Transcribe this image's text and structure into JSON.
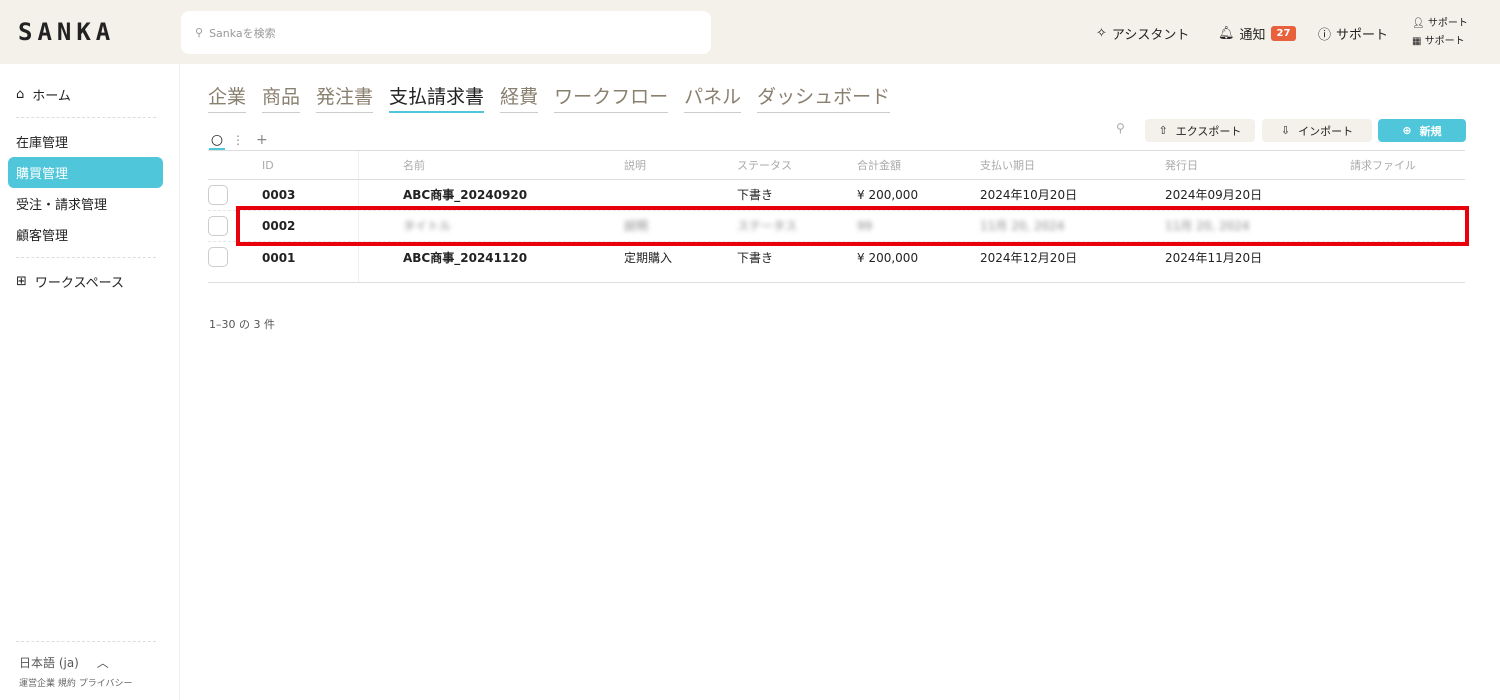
{
  "header": {
    "logo": "SANKA",
    "search_placeholder": "Sankaを検索",
    "assistant": "アシスタント",
    "notifications": "通知",
    "notification_count": "27",
    "support": "サポート",
    "user_line1": "サポート",
    "user_line2": "サポート"
  },
  "sidebar": {
    "home": "ホーム",
    "items": [
      "在庫管理",
      "購買管理",
      "受注・請求管理",
      "顧客管理"
    ],
    "workspace": "ワークスペース",
    "language": "日本語 (ja)",
    "footer": "運営企業 規約 プライバシー"
  },
  "tabs": [
    "企業",
    "商品",
    "発注書",
    "支払請求書",
    "経費",
    "ワークフロー",
    "パネル",
    "ダッシュボード"
  ],
  "toolbar": {
    "export": "エクスポート",
    "import": "インポート",
    "new": "新規"
  },
  "table": {
    "columns": [
      "ID",
      "名前",
      "説明",
      "ステータス",
      "合計金額",
      "支払い期日",
      "発行日",
      "請求ファイル"
    ],
    "rows": [
      [
        "0003",
        "ABC商事_20240920",
        "",
        "下書き",
        "¥ 200,000",
        "2024年10月20日",
        "2024年09月20日",
        ""
      ],
      [
        "0002",
        "タイトル",
        "説明",
        "ステータス",
        "99",
        "11月 20, 2024",
        "11月 20, 2024",
        ""
      ],
      [
        "0001",
        "ABC商事_20241120",
        "定期購入",
        "下書き",
        "¥ 200,000",
        "2024年12月20日",
        "2024年11月20日",
        ""
      ]
    ]
  },
  "pagination": "1–30 の 3 件",
  "colors": {
    "accent": "#4fc6d9",
    "highlight": "#e8000b",
    "badge": "#e8603c"
  }
}
